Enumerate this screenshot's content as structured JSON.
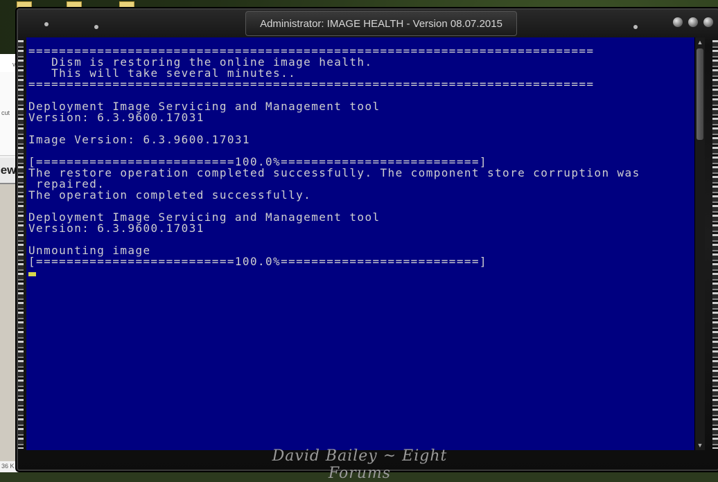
{
  "window": {
    "title": "Administrator:  IMAGE HEALTH - Version 08.07.2015",
    "footer_signature": "David Bailey ~ Eight Forums"
  },
  "background_app": {
    "partial_labels": [
      "v",
      "cut",
      "iew",
      "36 K"
    ]
  },
  "console": {
    "lines": [
      "==========================================================================",
      "   Dism is restoring the online image health.",
      "   This will take several minutes..",
      "==========================================================================",
      "",
      "Deployment Image Servicing and Management tool",
      "Version: 6.3.9600.17031",
      "",
      "Image Version: 6.3.9600.17031",
      "",
      "[==========================100.0%==========================]",
      "The restore operation completed successfully. The component store corruption was",
      " repaired.",
      "The operation completed successfully.",
      "",
      "Deployment Image Servicing and Management tool",
      "Version: 6.3.9600.17031",
      "",
      "Unmounting image",
      "[==========================100.0%==========================]"
    ],
    "background_color": "#000080",
    "text_color": "#cfcfcf",
    "cursor_color": "#d8d84a"
  },
  "scrollbar": {
    "up_icon": "arrow-up-icon",
    "down_icon": "arrow-down-icon"
  }
}
